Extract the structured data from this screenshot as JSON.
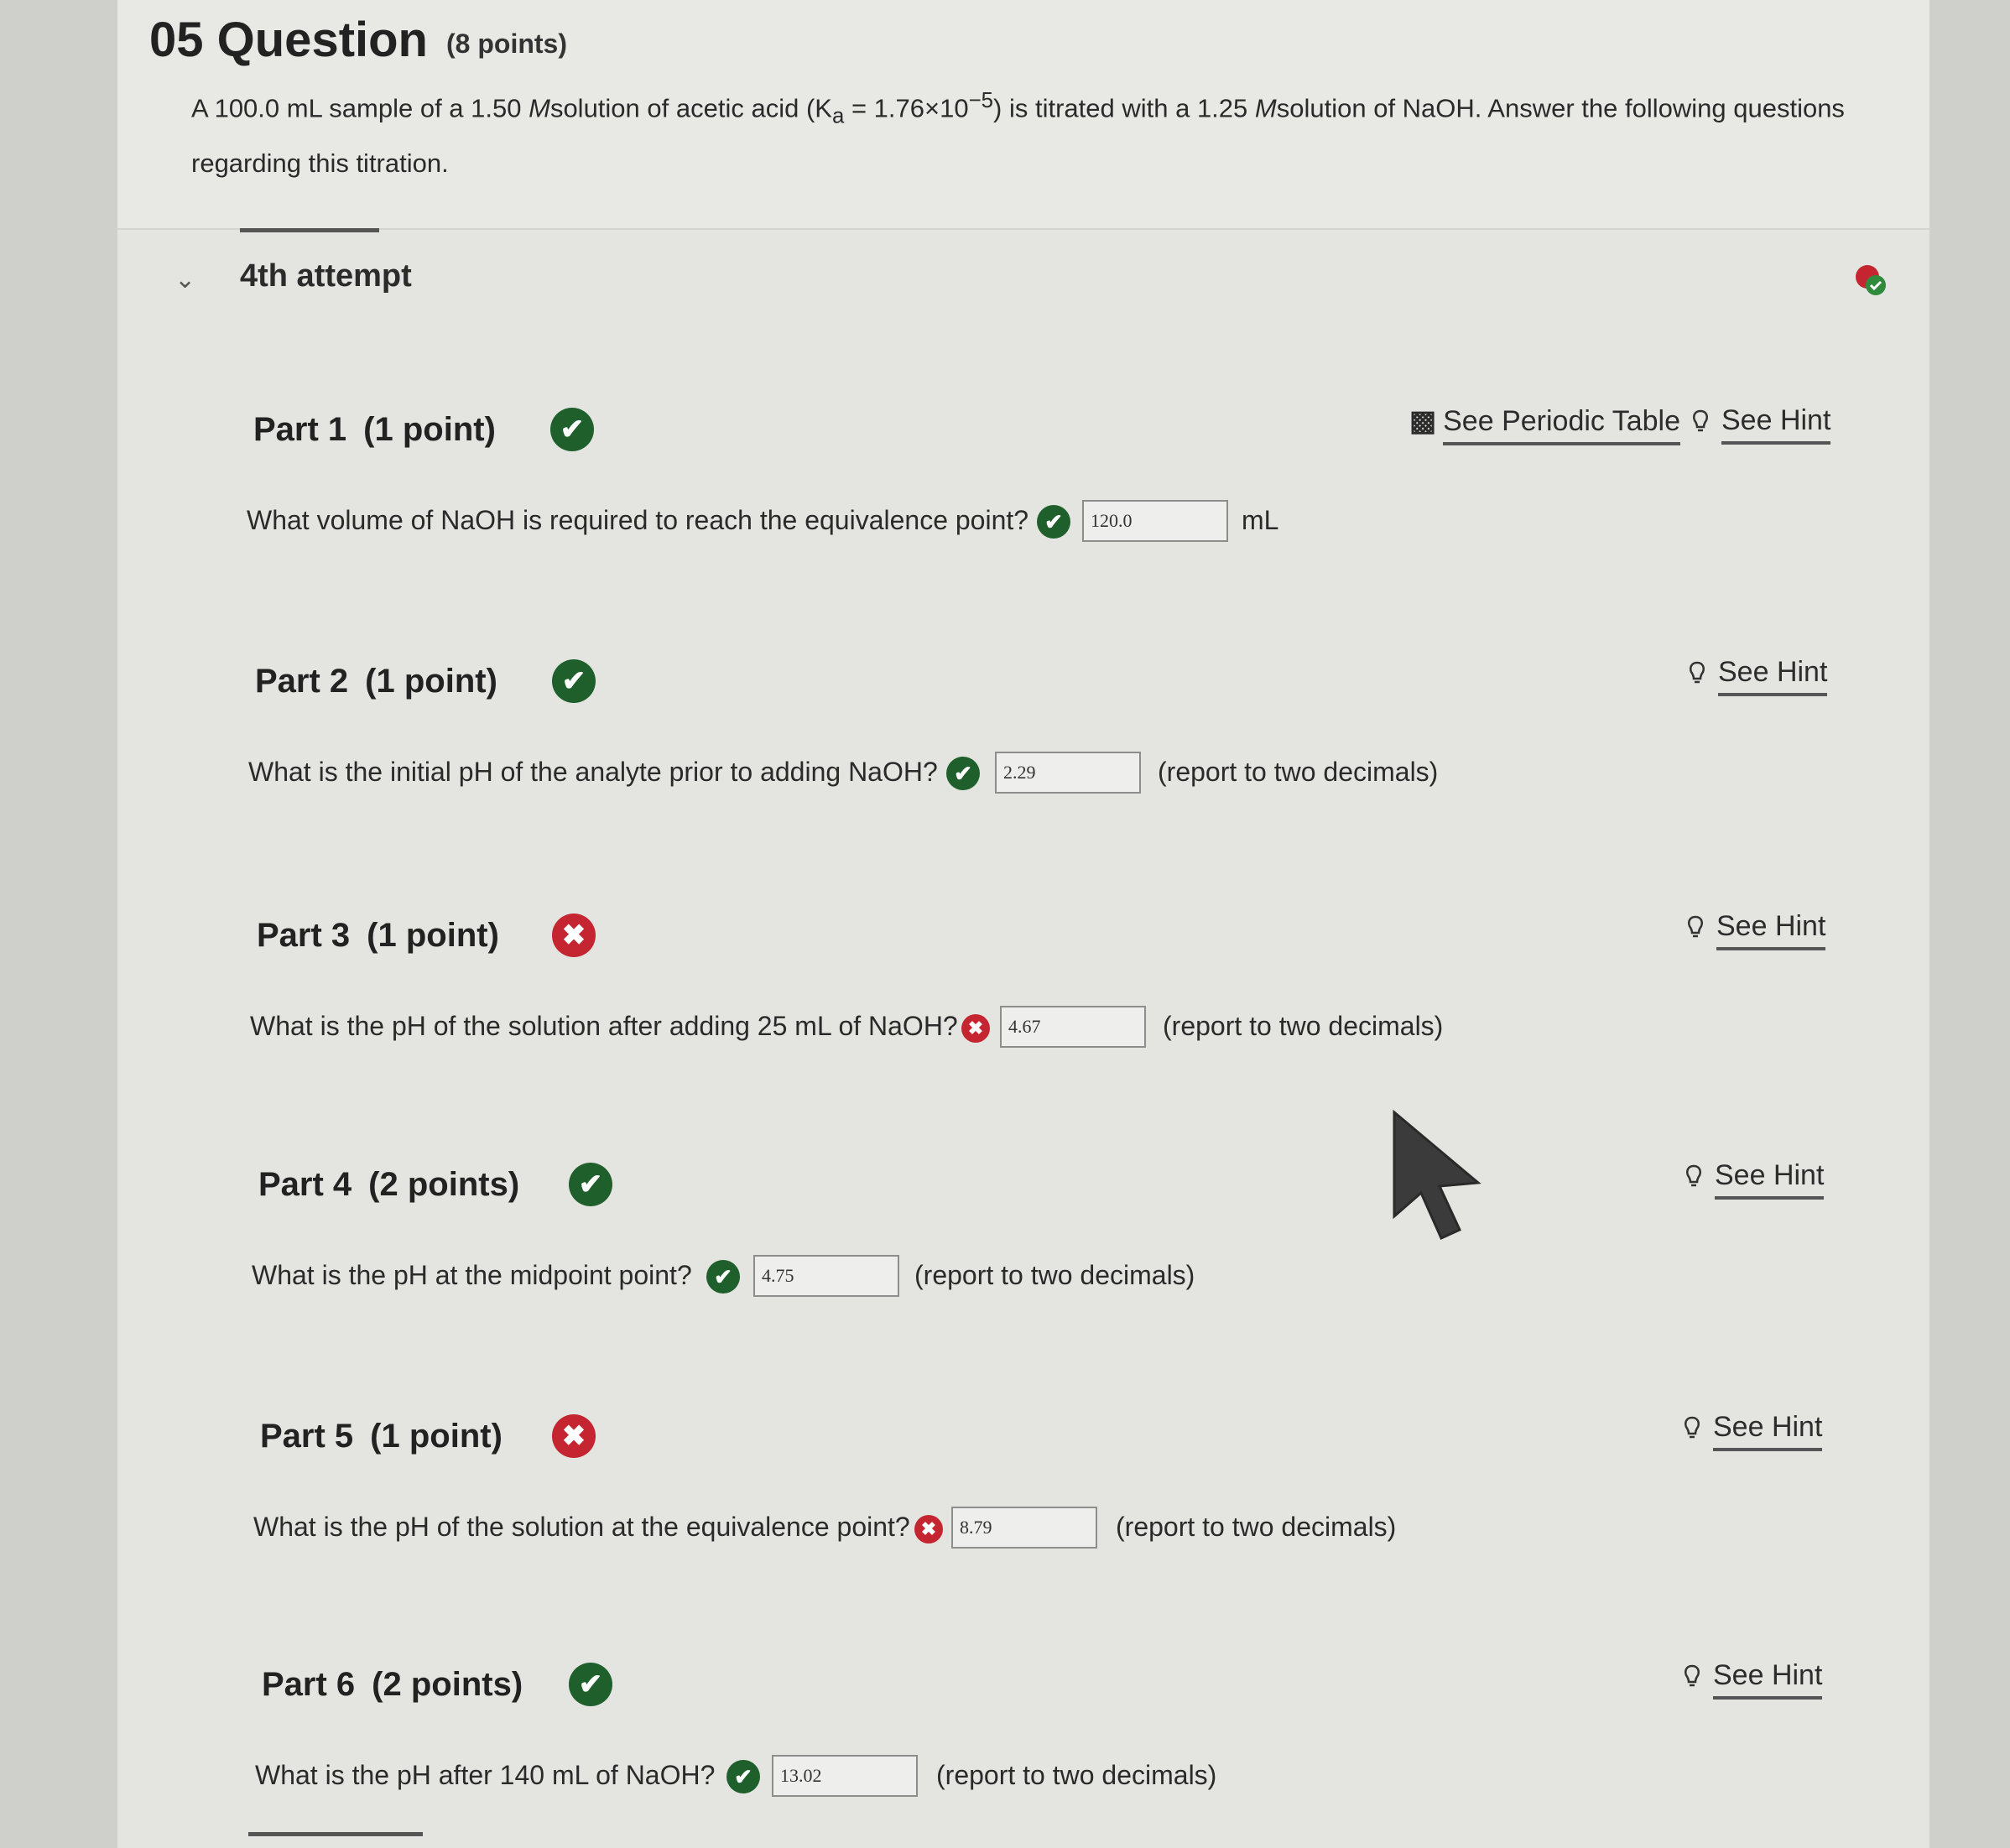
{
  "question": {
    "number": "05",
    "title": "Question",
    "points": "(8 points)",
    "text_pre": "A 100.0 mL sample of a 1.50 ",
    "M1": "M",
    "text_mid": "solution of acetic acid (K",
    "ka_sub": "a",
    "text_mid2": " = 1.76×10",
    "ka_exp": "−5",
    "text_mid3": ") is titrated with a 1.25 ",
    "M2": "M",
    "text_post": "solution of NaOH. Answer the following questions regarding this titration."
  },
  "attempt": {
    "label": "4th attempt"
  },
  "periodic_table": {
    "label": "See Periodic Table"
  },
  "parts": [
    {
      "title": "Part 1",
      "points": "(1 point)",
      "status": "correct",
      "question": "What volume of NaOH is required to reach the equivalence point?",
      "answer": "120.0",
      "suffix": "mL",
      "answer_status": "correct",
      "hint": "See Hint"
    },
    {
      "title": "Part 2",
      "points": "(1 point)",
      "status": "correct",
      "question": "What is the initial pH of the analyte prior to adding NaOH?",
      "answer": "2.29",
      "suffix": "(report to two decimals)",
      "answer_status": "correct",
      "hint": "See Hint"
    },
    {
      "title": "Part 3",
      "points": "(1 point)",
      "status": "incorrect",
      "question": "What is the pH of the solution after adding 25 mL of NaOH?",
      "answer": "4.67",
      "suffix": "(report to two decimals)",
      "answer_status": "incorrect",
      "hint": "See Hint"
    },
    {
      "title": "Part 4",
      "points": "(2 points)",
      "status": "correct",
      "question": "What is the pH at the midpoint point?",
      "answer": "4.75",
      "suffix": "(report to two decimals)",
      "answer_status": "correct",
      "hint": "See Hint"
    },
    {
      "title": "Part 5",
      "points": "(1 point)",
      "status": "incorrect",
      "question": "What is the pH of the solution at the equivalence point?",
      "answer": "8.79",
      "suffix": "(report to two decimals)",
      "answer_status": "incorrect",
      "hint": "See Hint"
    },
    {
      "title": "Part 6",
      "points": "(2 points)",
      "status": "correct",
      "question": "What is the pH after 140 mL of NaOH?",
      "answer": "13.02",
      "suffix": "(report to two decimals)",
      "answer_status": "correct",
      "hint": "See Hint"
    }
  ],
  "colors": {
    "correct": "#1f5f2b",
    "incorrect": "#c42530"
  }
}
